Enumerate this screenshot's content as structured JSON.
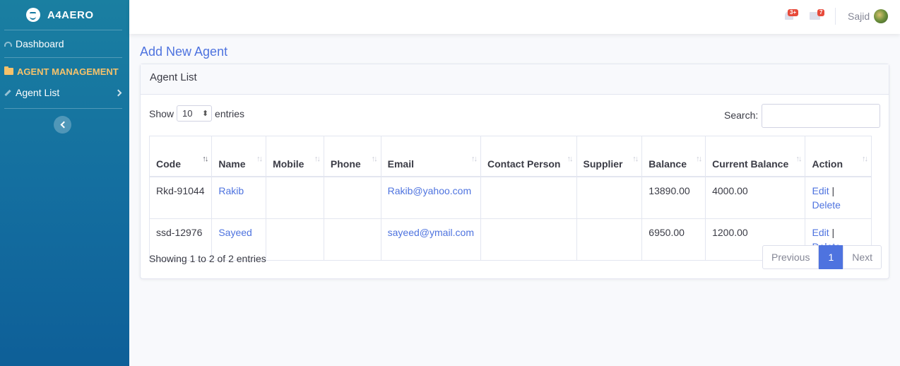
{
  "brand": {
    "name": "A4AERO"
  },
  "sidebar": {
    "dashboard": "Dashboard",
    "heading": "AGENT MANAGEMENT",
    "agent_list": "Agent List"
  },
  "topbar": {
    "alerts_badge": "3+",
    "messages_badge": "7",
    "user": "Sajid"
  },
  "page": {
    "title": "Add New Agent"
  },
  "card": {
    "title": "Agent List"
  },
  "controls": {
    "show": "Show",
    "entries_value": "10",
    "entries": "entries",
    "search": "Search:"
  },
  "table": {
    "headers": [
      "Code",
      "Name",
      "Mobile",
      "Phone",
      "Email",
      "Contact Person",
      "Supplier",
      "Balance",
      "Current Balance",
      "Action"
    ],
    "rows": [
      {
        "code": "Rkd-91044",
        "name": "Rakib",
        "mobile": "",
        "phone": "",
        "email": "Rakib@yahoo.com",
        "contact": "",
        "supplier": "",
        "balance": "13890.00",
        "current": "4000.00",
        "edit": "Edit",
        "sep": "|",
        "delete": "Delete"
      },
      {
        "code": "ssd-12976",
        "name": "Sayeed",
        "mobile": "",
        "phone": "",
        "email": "sayeed@ymail.com",
        "contact": "",
        "supplier": "",
        "balance": "6950.00",
        "current": "1200.00",
        "edit": "Edit",
        "sep": "|",
        "delete": "Delete"
      }
    ]
  },
  "footer": {
    "info": "Showing 1 to 2 of 2 entries",
    "previous": "Previous",
    "page": "1",
    "next": "Next"
  },
  "colors": {
    "primary": "#4e73df",
    "sidebar": "#146fa0",
    "heading": "#f6c26b",
    "badge": "#e74a3b"
  }
}
